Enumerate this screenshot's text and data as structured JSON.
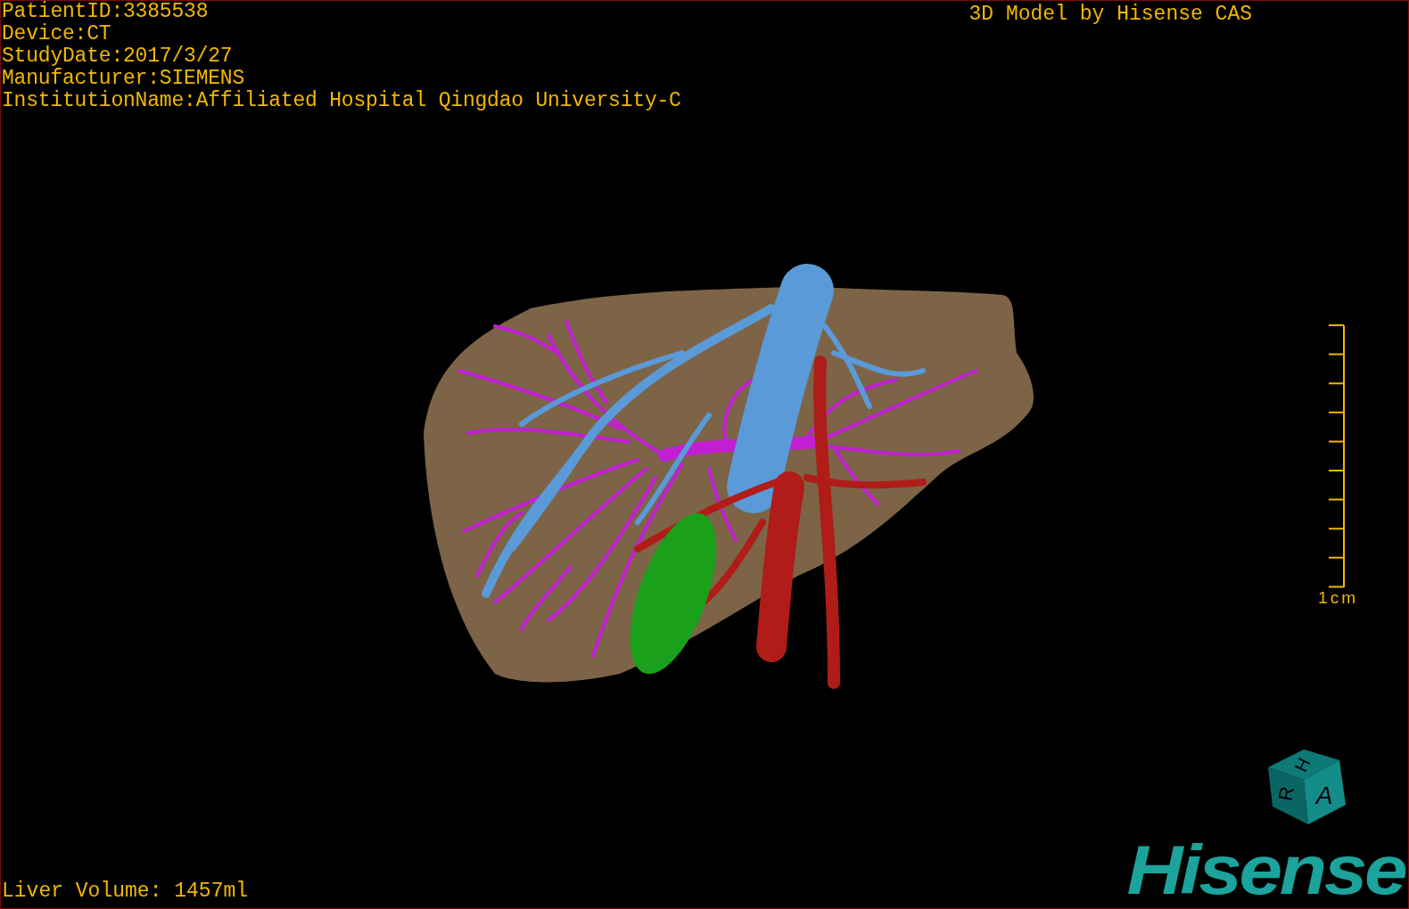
{
  "info_lines": [
    "PatientID:3385538",
    "Device:CT",
    "StudyDate:2017/3/27",
    "Manufacturer:SIEMENS",
    "InstitutionName:Affiliated Hospital Qingdao University-C"
  ],
  "title": "3D Model by Hisense CAS",
  "scale_bar": {
    "label": "1cm"
  },
  "liver_volume": "Liver Volume: 1457ml",
  "orientation_cube": {
    "faces": [
      "H",
      "R",
      "A"
    ]
  },
  "logo": "Hisense"
}
